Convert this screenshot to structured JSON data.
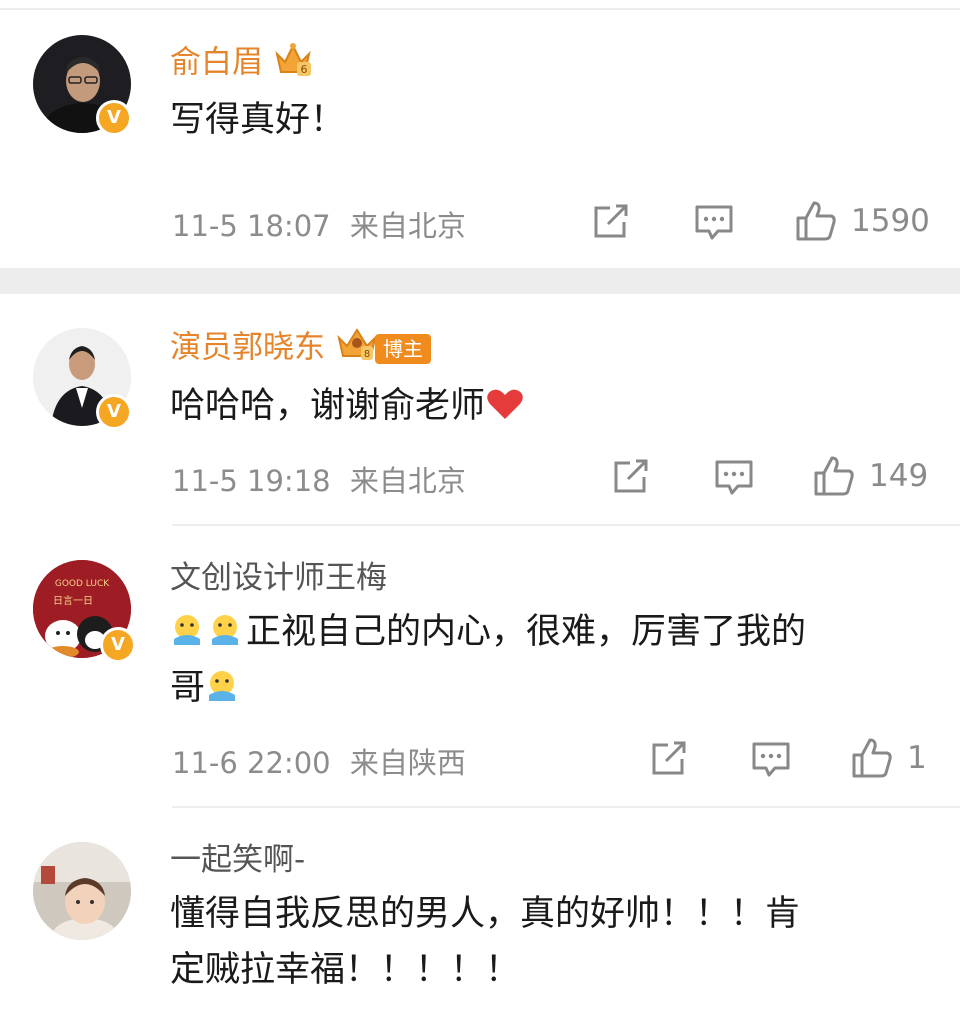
{
  "comments": [
    {
      "user": "俞白眉",
      "user_color": "#e5842a",
      "level_badge": "6",
      "text": "写得真好！",
      "time": "11-5 18:07",
      "location": "来自北京",
      "likes": "1590"
    },
    {
      "user": "演员郭晓东",
      "user_color": "#e5842a",
      "level_badge": "8",
      "role_badge": "博主",
      "text": "哈哈哈，谢谢俞老师",
      "text_emoji": "heart",
      "time": "11-5 19:18",
      "location": "来自北京",
      "likes": "149"
    },
    {
      "user": "文创设计师王梅",
      "user_color": "#555555",
      "avatar_text": "日言一日",
      "avatar_text2": "GOOD LUCK",
      "text_line1": "正视自己的内心，很难，厉害了我的",
      "text_line2": "哥",
      "text_emoji": "crying-face",
      "time": "11-6 22:00",
      "location": "来自陕西",
      "likes": "1"
    },
    {
      "user": "一起笑啊-",
      "user_color": "#555555",
      "text_line1": "懂得自我反思的男人，真的好帅！！！肯",
      "text_line2": "定贼拉幸福！！！！！"
    }
  ],
  "icons": {
    "share": "share-icon",
    "comment": "comment-icon",
    "like": "thumbs-up-icon",
    "verified": "verified-v-badge"
  },
  "colors": {
    "accent": "#e5842a",
    "verified": "#f5a623",
    "meta": "#8c8c8c"
  }
}
